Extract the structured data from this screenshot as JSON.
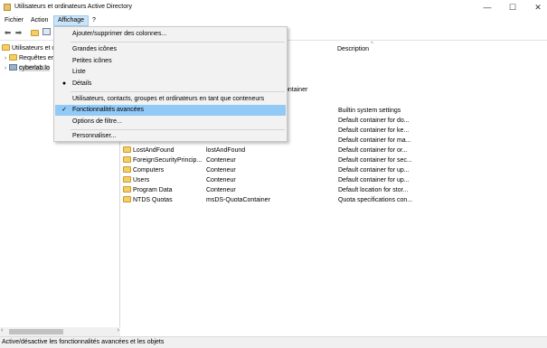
{
  "window": {
    "title": "Utilisateurs et ordinateurs Active Directory"
  },
  "window_controls": {
    "minimize": "—",
    "maximize": "☐",
    "close": "✕"
  },
  "menubar": {
    "items": [
      "Fichier",
      "Action",
      "Affichage",
      "?"
    ]
  },
  "toolbar": {
    "back": "⬅",
    "forward": "➡"
  },
  "tree": {
    "items": [
      {
        "label": "Utilisateurs et c",
        "expander": ""
      },
      {
        "label": "Requêtes er",
        "expander": "›"
      },
      {
        "label": "cyberlab.lo",
        "expander": "›"
      }
    ]
  },
  "scroll": {
    "left": "‹",
    "right": "›"
  },
  "list": {
    "header": {
      "description": "Description",
      "caret": "^"
    },
    "partial_type": "ontainer",
    "rows": [
      {
        "name": "",
        "type": "",
        "desc": "Builtin system settings"
      },
      {
        "name": "",
        "type": "",
        "desc": "Default container for do..."
      },
      {
        "name": "",
        "type": "",
        "desc": "Default container for ke..."
      },
      {
        "name": "",
        "type": "",
        "desc": "Default container for ma..."
      },
      {
        "name": "LostAndFound",
        "type": "lostAndFound",
        "desc": "Default container for or..."
      },
      {
        "name": "ForeignSecurityPrincip...",
        "type": "Conteneur",
        "desc": "Default container for sec..."
      },
      {
        "name": "Computers",
        "type": "Conteneur",
        "desc": "Default container for up..."
      },
      {
        "name": "Users",
        "type": "Conteneur",
        "desc": "Default container for up..."
      },
      {
        "name": "Program Data",
        "type": "Conteneur",
        "desc": "Default location for stor..."
      },
      {
        "name": "NTDS Quotas",
        "type": "msDS-QuotaContainer",
        "desc": "Quota specifications con..."
      }
    ]
  },
  "dropdown": {
    "items": [
      {
        "label": "Ajouter/supprimer des colonnes...",
        "mark": ""
      },
      {
        "label": "Grandes icônes",
        "mark": ""
      },
      {
        "label": "Petites icônes",
        "mark": ""
      },
      {
        "label": "Liste",
        "mark": ""
      },
      {
        "label": "Détails",
        "mark": "●"
      },
      {
        "label": "Utilisateurs, contacts, groupes et ordinateurs en tant que conteneurs",
        "mark": ""
      },
      {
        "label": "Fonctionnalités avancées",
        "mark": "✓"
      },
      {
        "label": "Options de filtre...",
        "mark": ""
      },
      {
        "label": "Personnaliser...",
        "mark": ""
      }
    ]
  },
  "status": {
    "text": "Active/désactive les fonctionnalités avancées et les objets"
  },
  "colors": {
    "menu_highlight": "#91c9f7",
    "active_menu": "#cce4f7",
    "folder": "#f4cf67"
  }
}
